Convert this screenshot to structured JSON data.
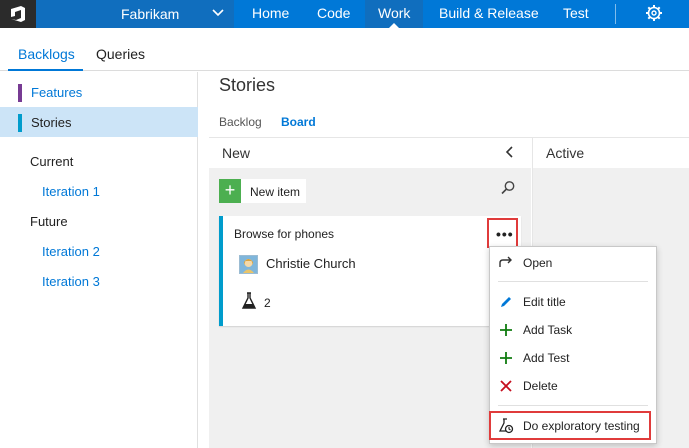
{
  "topbar": {
    "project": "Fabrikam",
    "nav": [
      "Home",
      "Code",
      "Work",
      "Build & Release",
      "Test"
    ],
    "active_nav": "Work"
  },
  "subtabs": {
    "items": [
      "Backlogs",
      "Queries"
    ],
    "active": "Backlogs"
  },
  "sidebar": {
    "levels": [
      {
        "label": "Features",
        "color": "#773b93"
      },
      {
        "label": "Stories",
        "color": "#009ccc"
      }
    ],
    "selected": "Stories",
    "current_heading": "Current",
    "current_items": [
      "Iteration 1"
    ],
    "future_heading": "Future",
    "future_items": [
      "Iteration 2",
      "Iteration 3"
    ]
  },
  "main": {
    "title": "Stories",
    "pivots": [
      "Backlog",
      "Board"
    ],
    "active_pivot": "Board",
    "columns": [
      "New",
      "Active"
    ],
    "new_item_label": "New item"
  },
  "card": {
    "title": "Browse for phones",
    "assignee": "Christie Church",
    "test_count": "2",
    "accent": "#009ccc"
  },
  "menu": {
    "items": [
      "Open",
      "Edit title",
      "Add Task",
      "Add Test",
      "Delete",
      "Do exploratory testing"
    ]
  },
  "colors": {
    "brand": "#0078d7",
    "highlight": "#e03b3b",
    "add_green": "#4caf50"
  }
}
